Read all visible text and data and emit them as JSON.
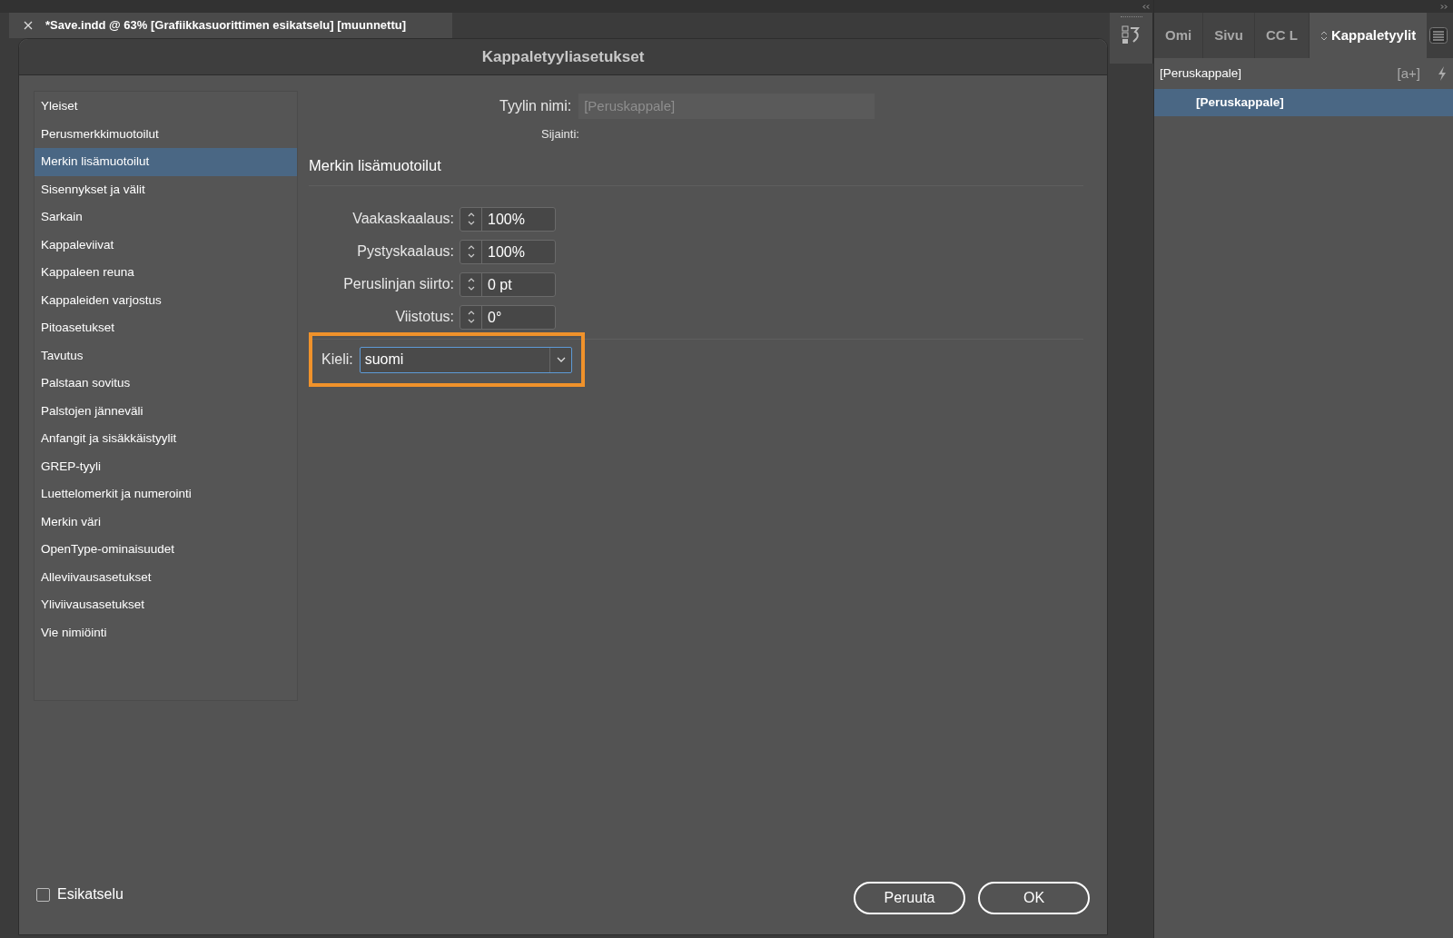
{
  "document_tab": {
    "title": "*Save.indd @ 63% [Grafiikkasuorittimen esikatselu] [muunnettu]"
  },
  "dialog": {
    "title": "Kappaletyyliasetukset",
    "sidebar": [
      {
        "label": "Yleiset",
        "selected": false
      },
      {
        "label": "Perusmerkkimuotoilut",
        "selected": false
      },
      {
        "label": "Merkin lisämuotoilut",
        "selected": true
      },
      {
        "label": "Sisennykset ja välit",
        "selected": false
      },
      {
        "label": "Sarkain",
        "selected": false
      },
      {
        "label": "Kappaleviivat",
        "selected": false
      },
      {
        "label": "Kappaleen reuna",
        "selected": false
      },
      {
        "label": "Kappaleiden varjostus",
        "selected": false
      },
      {
        "label": "Pitoasetukset",
        "selected": false
      },
      {
        "label": "Tavutus",
        "selected": false
      },
      {
        "label": "Palstaan sovitus",
        "selected": false
      },
      {
        "label": "Palstojen jänneväli",
        "selected": false
      },
      {
        "label": "Anfangit ja sisäkkäistyylit",
        "selected": false
      },
      {
        "label": "GREP-tyyli",
        "selected": false
      },
      {
        "label": "Luettelomerkit ja numerointi",
        "selected": false
      },
      {
        "label": "Merkin väri",
        "selected": false
      },
      {
        "label": "OpenType-ominaisuudet",
        "selected": false
      },
      {
        "label": "Alleviivausasetukset",
        "selected": false
      },
      {
        "label": "Yliviivausasetukset",
        "selected": false
      },
      {
        "label": "Vie nimiöinti",
        "selected": false
      }
    ],
    "style_name": {
      "label": "Tyylin nimi:",
      "value": "[Peruskappale]",
      "disabled": true
    },
    "location": {
      "label": "Sijainti:"
    },
    "section_title": "Merkin lisämuotoilut",
    "fields": [
      {
        "label": "Vaakaskaalaus:",
        "value": "100%"
      },
      {
        "label": "Pystyskaalaus:",
        "value": "100%"
      },
      {
        "label": "Peruslinjan siirto:",
        "value": "0 pt"
      },
      {
        "label": "Viistotus:",
        "value": "0°"
      }
    ],
    "language": {
      "label": "Kieli:",
      "value": "suomi",
      "highlighted": true
    },
    "preview": {
      "label": "Esikatselu",
      "checked": false
    },
    "buttons": [
      "Peruuta",
      "OK"
    ]
  },
  "panel": {
    "tabs": [
      {
        "label": "Omi",
        "selected": false
      },
      {
        "label": "Sivu",
        "selected": false
      },
      {
        "label": "CC L",
        "selected": false
      },
      {
        "label": "Kappaletyylit",
        "selected": true
      }
    ],
    "header": "[Peruskappale]",
    "new_style_button": "[a+]",
    "styles": [
      {
        "label": "[Peruskappale]",
        "selected": true
      }
    ]
  }
}
